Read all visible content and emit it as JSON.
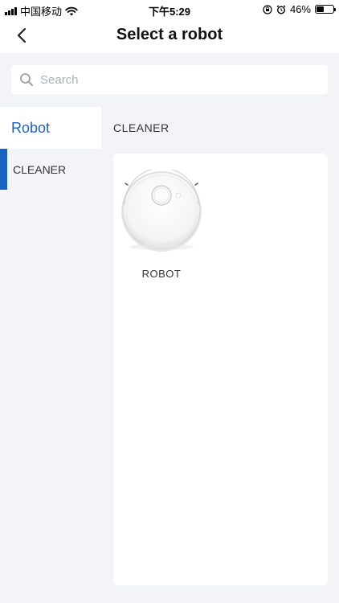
{
  "status_bar": {
    "carrier": "中国移动",
    "time": "下午5:29",
    "battery_percent": "46%",
    "battery_level": 0.46
  },
  "nav": {
    "title": "Select a robot",
    "back_icon": "chevron-left-icon"
  },
  "search": {
    "placeholder": "Search",
    "value": ""
  },
  "sidebar": {
    "header": "Robot",
    "items": [
      {
        "label": "CLEANER",
        "active": true
      }
    ]
  },
  "main": {
    "section_title": "CLEANER",
    "robots": [
      {
        "label": "ROBOT",
        "icon": "robot-vacuum-icon"
      }
    ]
  },
  "colors": {
    "accent": "#1763c4",
    "background": "#f3f4f8",
    "surface": "#ffffff"
  }
}
